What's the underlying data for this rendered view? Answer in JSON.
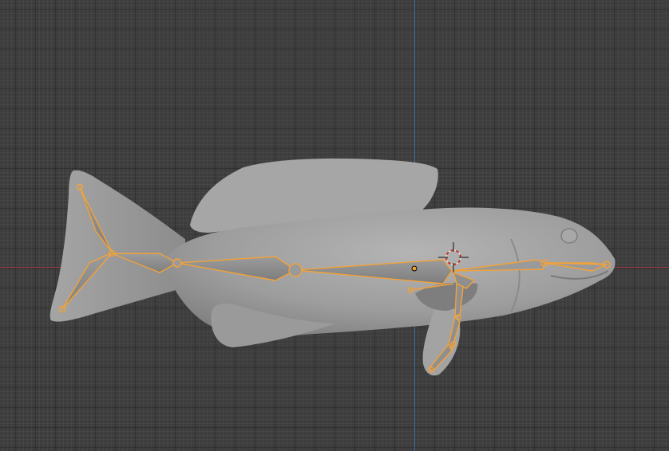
{
  "viewport": {
    "mode": "3d-viewport",
    "grid": true,
    "colors": {
      "background": "#3d3d3d",
      "axis_x": "#9b3a43",
      "axis_y": "#3f6d9c",
      "mesh": "#9e9e9e",
      "armature_selected": "#f2a23a",
      "cursor": "#d7d7d7"
    }
  },
  "scene": {
    "mesh_object": "fish-mesh",
    "armature_object": "fish-armature",
    "cursor_icon": "3d-cursor-icon"
  }
}
